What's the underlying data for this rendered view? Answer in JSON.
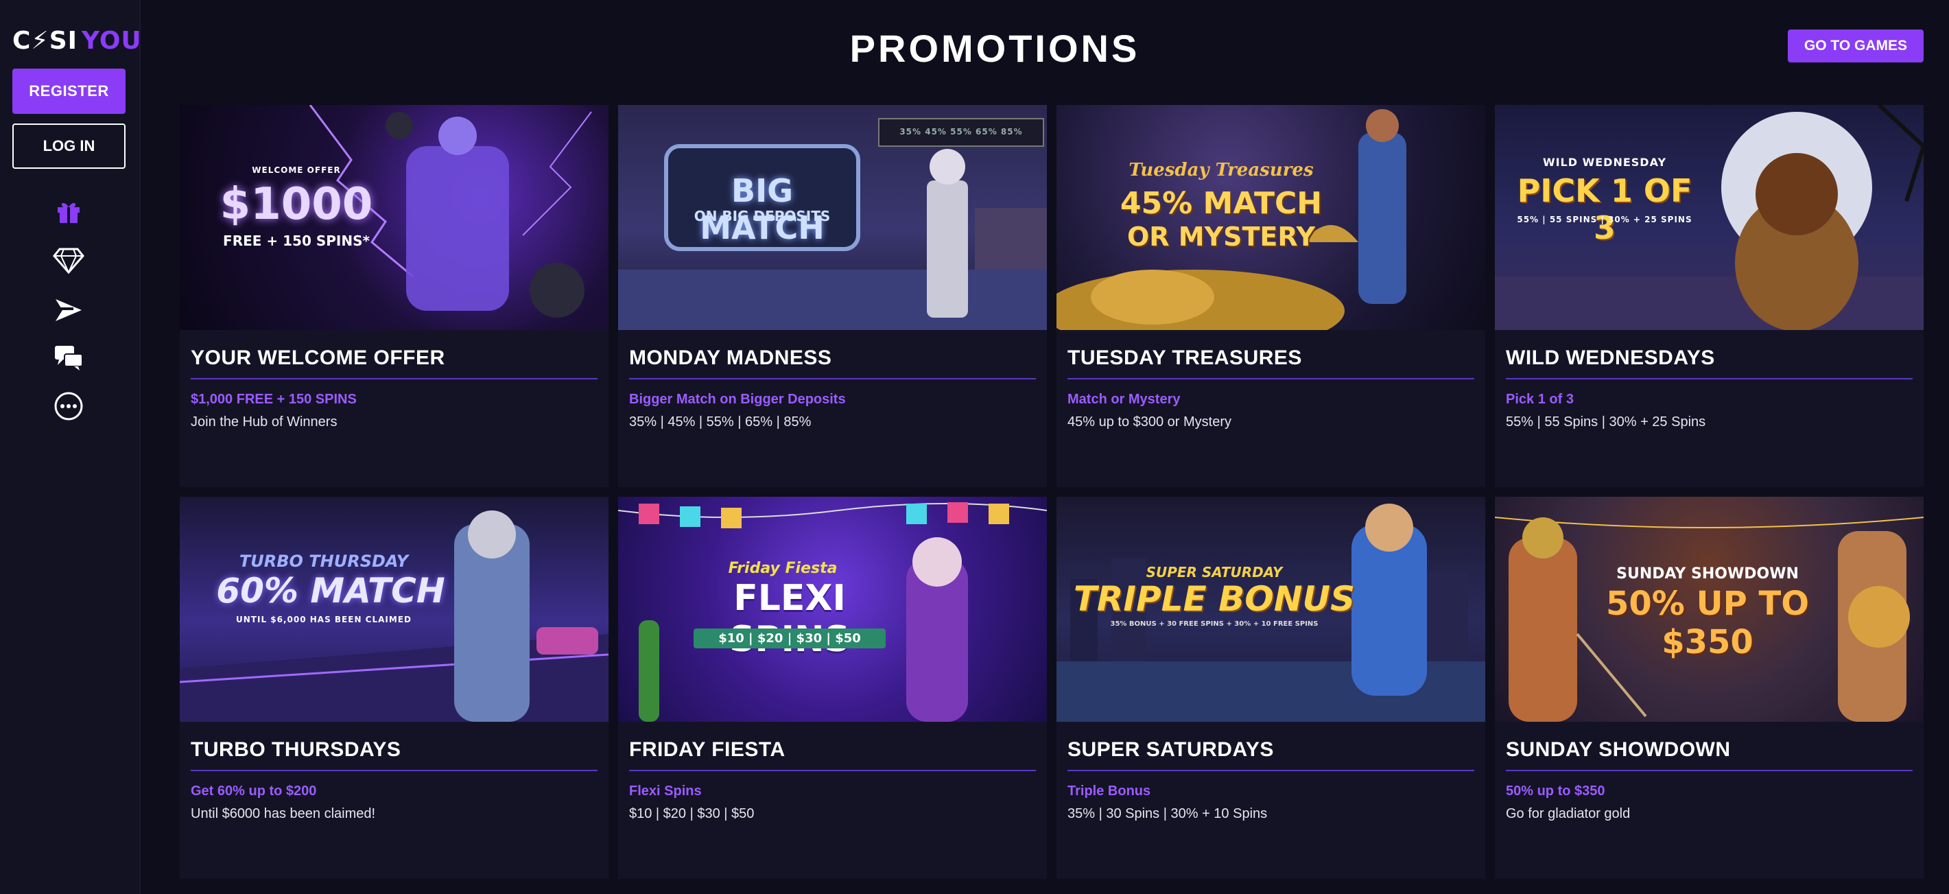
{
  "logo": {
    "part1": "C⚡SI",
    "part2": "YOU"
  },
  "sidebar": {
    "register": "REGISTER",
    "login": "LOG IN"
  },
  "header": {
    "title": "PROMOTIONS",
    "games_button": "GO TO GAMES"
  },
  "colors": {
    "accent": "#8a3cf7",
    "background": "#0e0d1b",
    "card": "#141326"
  },
  "promos": [
    {
      "title": "YOUR WELCOME OFFER",
      "sub": "$1,000 FREE + 150 SPINS",
      "desc": "Join the Hub of Winners",
      "art": {
        "l1": "WELCOME OFFER",
        "l2": "$1000",
        "l3": "FREE + 150 SPINS*"
      }
    },
    {
      "title": "MONDAY MADNESS",
      "sub": "Bigger Match on Bigger Deposits",
      "desc": "35% | 45% | 55% | 65% | 85%",
      "art": {
        "l1": "BIG MATCH",
        "l2": "ON BIG DEPOSITS",
        "l3": "35% 45% 55% 65% 85%"
      }
    },
    {
      "title": "TUESDAY TREASURES",
      "sub": "Match or Mystery",
      "desc": "45% up to $300 or Mystery",
      "art": {
        "l1": "Tuesday Treasures",
        "l2": "45% MATCH",
        "l3": "OR MYSTERY"
      }
    },
    {
      "title": "WILD WEDNESDAYS",
      "sub": "Pick 1 of 3",
      "desc": "55% | 55 Spins | 30% + 25 Spins",
      "art": {
        "l1": "WILD WEDNESDAY",
        "l2": "PICK 1 OF 3",
        "l3": "55% | 55 SPINS | 30% + 25 SPINS"
      }
    },
    {
      "title": "TURBO THURSDAYS",
      "sub": "Get 60% up to $200",
      "desc": "Until $6000 has been claimed!",
      "art": {
        "l1": "TURBO THURSDAY",
        "l2": "60% MATCH",
        "l3": "UNTIL $6,000 HAS BEEN CLAIMED"
      }
    },
    {
      "title": "FRIDAY FIESTA",
      "sub": "Flexi Spins",
      "desc": "$10 | $20 | $30 | $50",
      "art": {
        "l1": "Friday Fiesta",
        "l2": "FLEXI SPINS",
        "l3": "$10 | $20 | $30 | $50"
      }
    },
    {
      "title": "SUPER SATURDAYS",
      "sub": "Triple Bonus",
      "desc": "35% | 30 Spins | 30% + 10 Spins",
      "art": {
        "l1": "SUPER SATURDAY",
        "l2": "TRIPLE BONUS",
        "l3": "35% BONUS + 30 FREE SPINS + 30% + 10 FREE SPINS"
      }
    },
    {
      "title": "SUNDAY SHOWDOWN",
      "sub": "50% up to $350",
      "desc": "Go for gladiator gold",
      "art": {
        "l1": "SUNDAY SHOWDOWN",
        "l2": "50% UP TO $350",
        "l3": ""
      }
    }
  ]
}
